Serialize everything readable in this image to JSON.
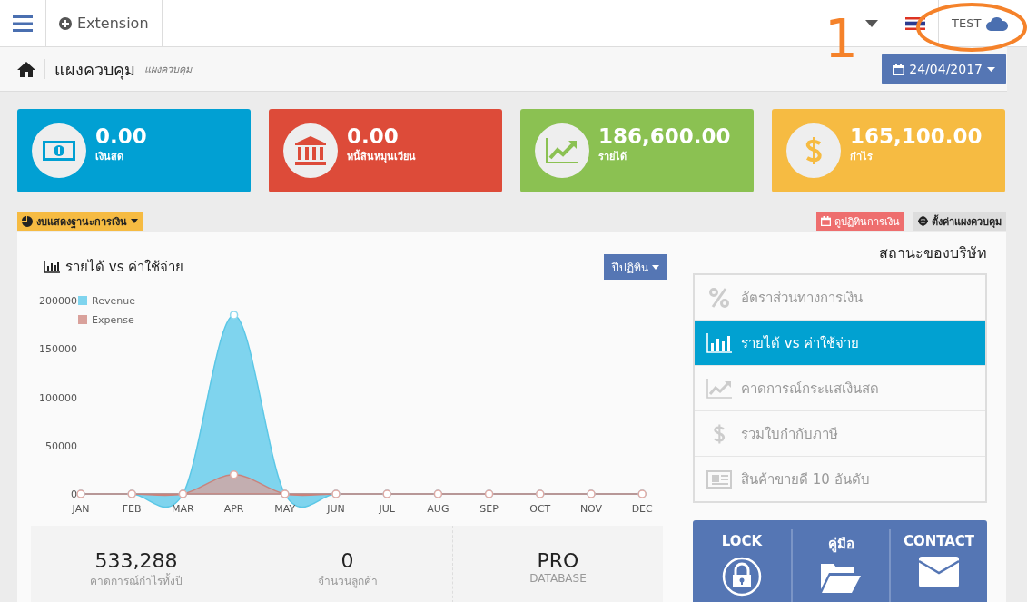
{
  "navbar": {
    "extension_label": "Extension",
    "user": "TEST",
    "annotation": "1"
  },
  "breadcrumb": {
    "title": "แผงควบคุม",
    "subtitle": "แผงควบคุม",
    "date": "24/04/2017"
  },
  "cards": [
    {
      "value": "0.00",
      "label": "เงินสด",
      "color": "#01a0d3",
      "kind": "money"
    },
    {
      "value": "0.00",
      "label": "หนี้สินหมุนเวียน",
      "color": "#dd4b39",
      "kind": "bank"
    },
    {
      "value": "186,600.00",
      "label": "รายได้",
      "color": "#8bc152",
      "kind": "chart"
    },
    {
      "value": "165,100.00",
      "label": "กำไร",
      "color": "#f6bb42",
      "kind": "dollar"
    }
  ],
  "toolbar": {
    "report_button": "งบแสดงฐานะการเงิน",
    "calendar_button": "ดูปฏิทินการเงิน",
    "settings_button": "ตั้งค่าแผงควบคุม"
  },
  "chart_panel": {
    "title": "รายได้ vs ค่าใช้จ่าย",
    "period_button": "ปีปฏิทิน",
    "chart_data": {
      "type": "area",
      "categories": [
        "JAN",
        "FEB",
        "MAR",
        "APR",
        "MAY",
        "JUN",
        "JUL",
        "AUG",
        "SEP",
        "OCT",
        "NOV",
        "DEC"
      ],
      "series": [
        {
          "name": "Revenue",
          "color": "#7fd4ee",
          "values": [
            0,
            0,
            0,
            185000,
            0,
            0,
            0,
            0,
            0,
            0,
            0,
            0
          ]
        },
        {
          "name": "Expense",
          "color": "#d9a19b",
          "values": [
            0,
            0,
            0,
            20000,
            0,
            0,
            0,
            0,
            0,
            0,
            0,
            0
          ]
        }
      ],
      "legend": true,
      "ylim": [
        0,
        200000
      ],
      "yticks": [
        0,
        50000,
        100000,
        150000,
        200000
      ]
    }
  },
  "stats": [
    {
      "value": "533,288",
      "label": "คาดการณ์กำไรทั้งปี"
    },
    {
      "value": "0",
      "label": "จำนวนลูกค้า"
    },
    {
      "value": "PRO",
      "label": "DATABASE"
    }
  ],
  "status_panel": {
    "title": "สถานะของบริษัท",
    "items": [
      {
        "label": "อัตราส่วนทางการเงิน",
        "kind": "percent",
        "selected": false
      },
      {
        "label": "รายได้ vs ค่าใช้จ่าย",
        "kind": "bars",
        "selected": true
      },
      {
        "label": "คาดการณ์กระแสเงินสด",
        "kind": "trend",
        "selected": false
      },
      {
        "label": "รวมใบกำกับภาษี",
        "kind": "dollar",
        "selected": false
      },
      {
        "label": "สินค้าขายดี 10 อันดับ",
        "kind": "news",
        "selected": false
      }
    ]
  },
  "quick_links": [
    {
      "label": "LOCK",
      "kind": "lock"
    },
    {
      "label": "คู่มือ",
      "kind": "folder"
    },
    {
      "label": "CONTACT",
      "kind": "mail"
    }
  ]
}
